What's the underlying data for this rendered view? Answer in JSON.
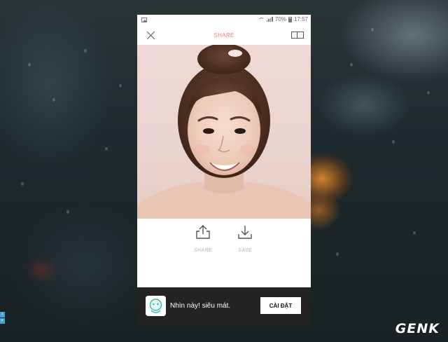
{
  "status_bar": {
    "battery_percent": "70%",
    "time": "17:57"
  },
  "header": {
    "title": "SHARE"
  },
  "actions": {
    "share_label": "SHARE",
    "save_label": "SAVE"
  },
  "ad": {
    "text": "Nhìn này! siêu mát.",
    "button_label": "CÀI ĐẶT"
  },
  "watermark": "GENK",
  "colors": {
    "title": "#f07a7a",
    "ad_background": "#232323",
    "action_label": "#c9c9c9",
    "adchoices": "#49a0c9"
  },
  "icons": {
    "close": "close-icon",
    "compare": "compare-icon",
    "share": "share-upload-icon",
    "save": "download-icon"
  }
}
